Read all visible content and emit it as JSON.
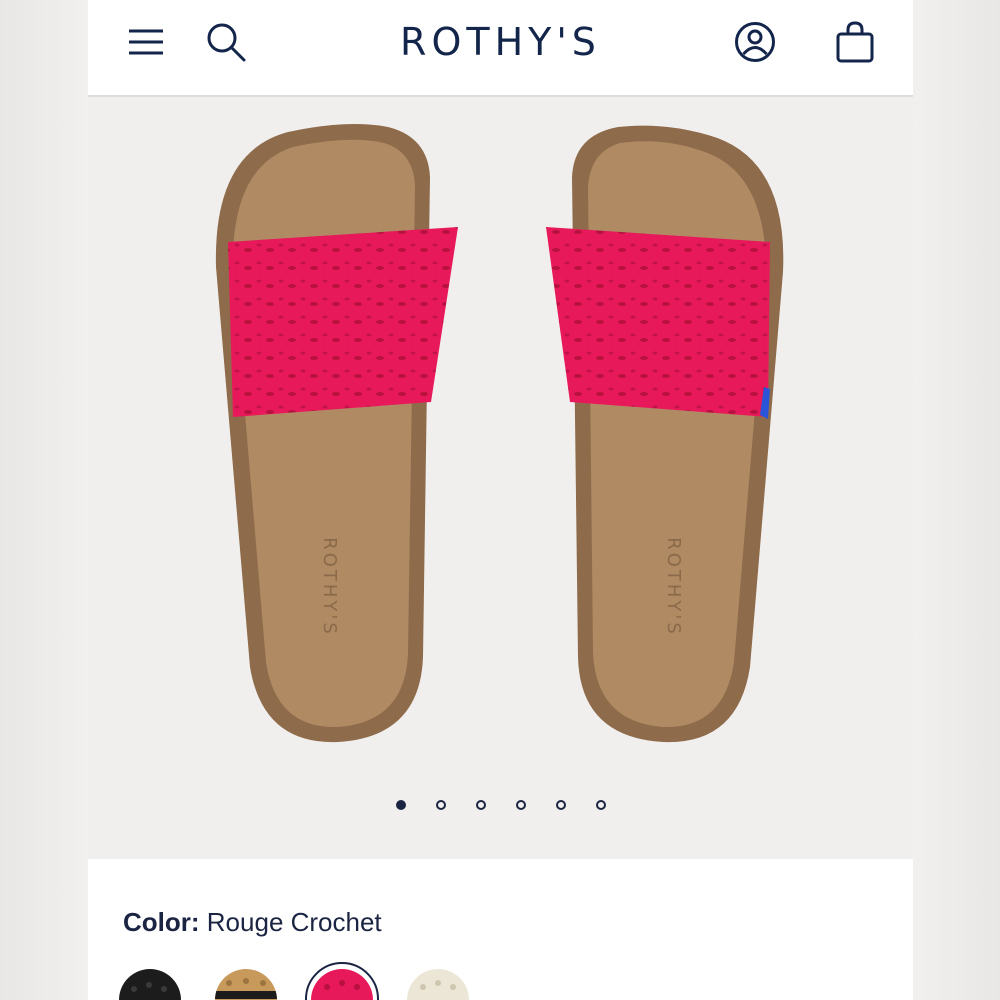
{
  "header": {
    "brand": "ROTHY'S",
    "icons": [
      "menu-icon",
      "search-icon",
      "account-icon",
      "bag-icon"
    ]
  },
  "product": {
    "insole_brand_text": "ROTHY'S",
    "strap_color": "#e8195a",
    "footbed_color": "#b08a63"
  },
  "carousel": {
    "total": 6,
    "active_index": 0
  },
  "color_selector": {
    "label": "Color:",
    "value": "Rouge Crochet",
    "swatches": [
      {
        "name": "black",
        "color": "#1c1c1c"
      },
      {
        "name": "tan",
        "color": "#c79a5b"
      },
      {
        "name": "rouge-crochet",
        "color": "#e8195a",
        "selected": true
      },
      {
        "name": "cream",
        "color": "#ece6d6"
      }
    ]
  },
  "colors": {
    "navy": "#13254a",
    "hero_bg": "#f1efed"
  }
}
